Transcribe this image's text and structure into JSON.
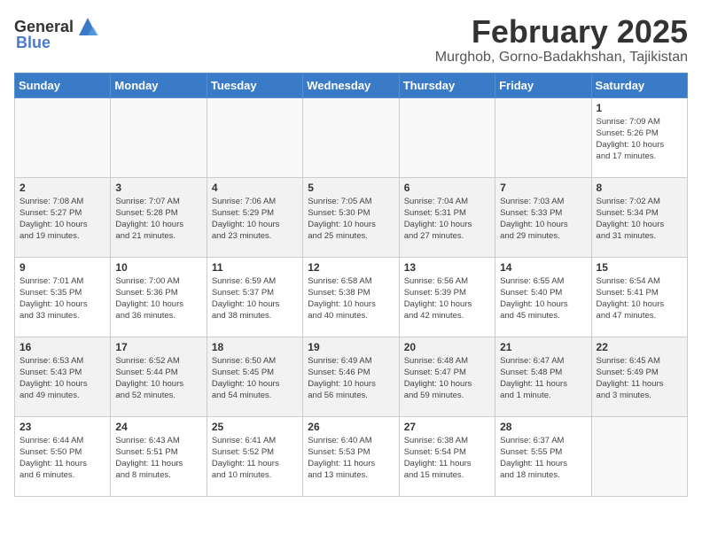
{
  "header": {
    "logo_general": "General",
    "logo_blue": "Blue",
    "month_year": "February 2025",
    "location": "Murghob, Gorno-Badakhshan, Tajikistan"
  },
  "calendar": {
    "columns": [
      "Sunday",
      "Monday",
      "Tuesday",
      "Wednesday",
      "Thursday",
      "Friday",
      "Saturday"
    ],
    "weeks": [
      [
        {
          "day": "",
          "info": ""
        },
        {
          "day": "",
          "info": ""
        },
        {
          "day": "",
          "info": ""
        },
        {
          "day": "",
          "info": ""
        },
        {
          "day": "",
          "info": ""
        },
        {
          "day": "",
          "info": ""
        },
        {
          "day": "1",
          "info": "Sunrise: 7:09 AM\nSunset: 5:26 PM\nDaylight: 10 hours\nand 17 minutes."
        }
      ],
      [
        {
          "day": "2",
          "info": "Sunrise: 7:08 AM\nSunset: 5:27 PM\nDaylight: 10 hours\nand 19 minutes."
        },
        {
          "day": "3",
          "info": "Sunrise: 7:07 AM\nSunset: 5:28 PM\nDaylight: 10 hours\nand 21 minutes."
        },
        {
          "day": "4",
          "info": "Sunrise: 7:06 AM\nSunset: 5:29 PM\nDaylight: 10 hours\nand 23 minutes."
        },
        {
          "day": "5",
          "info": "Sunrise: 7:05 AM\nSunset: 5:30 PM\nDaylight: 10 hours\nand 25 minutes."
        },
        {
          "day": "6",
          "info": "Sunrise: 7:04 AM\nSunset: 5:31 PM\nDaylight: 10 hours\nand 27 minutes."
        },
        {
          "day": "7",
          "info": "Sunrise: 7:03 AM\nSunset: 5:33 PM\nDaylight: 10 hours\nand 29 minutes."
        },
        {
          "day": "8",
          "info": "Sunrise: 7:02 AM\nSunset: 5:34 PM\nDaylight: 10 hours\nand 31 minutes."
        }
      ],
      [
        {
          "day": "9",
          "info": "Sunrise: 7:01 AM\nSunset: 5:35 PM\nDaylight: 10 hours\nand 33 minutes."
        },
        {
          "day": "10",
          "info": "Sunrise: 7:00 AM\nSunset: 5:36 PM\nDaylight: 10 hours\nand 36 minutes."
        },
        {
          "day": "11",
          "info": "Sunrise: 6:59 AM\nSunset: 5:37 PM\nDaylight: 10 hours\nand 38 minutes."
        },
        {
          "day": "12",
          "info": "Sunrise: 6:58 AM\nSunset: 5:38 PM\nDaylight: 10 hours\nand 40 minutes."
        },
        {
          "day": "13",
          "info": "Sunrise: 6:56 AM\nSunset: 5:39 PM\nDaylight: 10 hours\nand 42 minutes."
        },
        {
          "day": "14",
          "info": "Sunrise: 6:55 AM\nSunset: 5:40 PM\nDaylight: 10 hours\nand 45 minutes."
        },
        {
          "day": "15",
          "info": "Sunrise: 6:54 AM\nSunset: 5:41 PM\nDaylight: 10 hours\nand 47 minutes."
        }
      ],
      [
        {
          "day": "16",
          "info": "Sunrise: 6:53 AM\nSunset: 5:43 PM\nDaylight: 10 hours\nand 49 minutes."
        },
        {
          "day": "17",
          "info": "Sunrise: 6:52 AM\nSunset: 5:44 PM\nDaylight: 10 hours\nand 52 minutes."
        },
        {
          "day": "18",
          "info": "Sunrise: 6:50 AM\nSunset: 5:45 PM\nDaylight: 10 hours\nand 54 minutes."
        },
        {
          "day": "19",
          "info": "Sunrise: 6:49 AM\nSunset: 5:46 PM\nDaylight: 10 hours\nand 56 minutes."
        },
        {
          "day": "20",
          "info": "Sunrise: 6:48 AM\nSunset: 5:47 PM\nDaylight: 10 hours\nand 59 minutes."
        },
        {
          "day": "21",
          "info": "Sunrise: 6:47 AM\nSunset: 5:48 PM\nDaylight: 11 hours\nand 1 minute."
        },
        {
          "day": "22",
          "info": "Sunrise: 6:45 AM\nSunset: 5:49 PM\nDaylight: 11 hours\nand 3 minutes."
        }
      ],
      [
        {
          "day": "23",
          "info": "Sunrise: 6:44 AM\nSunset: 5:50 PM\nDaylight: 11 hours\nand 6 minutes."
        },
        {
          "day": "24",
          "info": "Sunrise: 6:43 AM\nSunset: 5:51 PM\nDaylight: 11 hours\nand 8 minutes."
        },
        {
          "day": "25",
          "info": "Sunrise: 6:41 AM\nSunset: 5:52 PM\nDaylight: 11 hours\nand 10 minutes."
        },
        {
          "day": "26",
          "info": "Sunrise: 6:40 AM\nSunset: 5:53 PM\nDaylight: 11 hours\nand 13 minutes."
        },
        {
          "day": "27",
          "info": "Sunrise: 6:38 AM\nSunset: 5:54 PM\nDaylight: 11 hours\nand 15 minutes."
        },
        {
          "day": "28",
          "info": "Sunrise: 6:37 AM\nSunset: 5:55 PM\nDaylight: 11 hours\nand 18 minutes."
        },
        {
          "day": "",
          "info": ""
        }
      ]
    ]
  }
}
